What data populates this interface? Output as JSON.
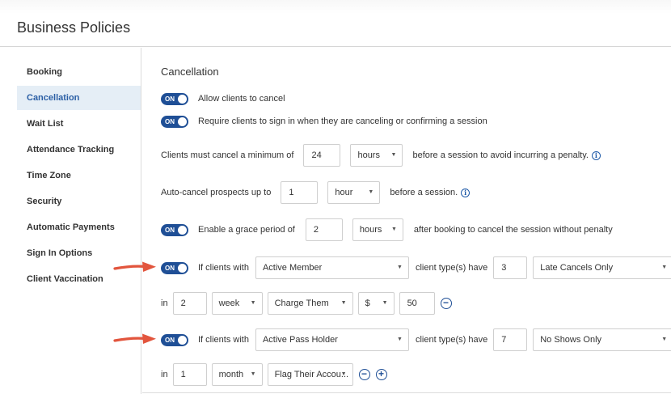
{
  "page": {
    "title": "Business Policies"
  },
  "sidebar": {
    "items": [
      {
        "label": "Booking",
        "active": false
      },
      {
        "label": "Cancellation",
        "active": true
      },
      {
        "label": "Wait List",
        "active": false
      },
      {
        "label": "Attendance Tracking",
        "active": false
      },
      {
        "label": "Time Zone",
        "active": false
      },
      {
        "label": "Security",
        "active": false
      },
      {
        "label": "Automatic Payments",
        "active": false
      },
      {
        "label": "Sign In Options",
        "active": false
      },
      {
        "label": "Client Vaccination",
        "active": false
      }
    ]
  },
  "cancellation": {
    "title": "Cancellation",
    "toggle_label": "ON",
    "allow_cancel": {
      "label": "Allow clients to cancel"
    },
    "require_sign_in": {
      "label": "Require clients to sign in when they are canceling or confirming a session"
    },
    "minimum": {
      "prefix": "Clients must cancel a minimum of",
      "value": "24",
      "unit": "hours",
      "suffix": "before a session to avoid incurring a penalty."
    },
    "auto_cancel": {
      "prefix": "Auto-cancel prospects up to",
      "value": "1",
      "unit": "hour",
      "suffix": "before a session."
    },
    "grace": {
      "prefix": "Enable a grace period of",
      "value": "2",
      "unit": "hours",
      "suffix": "after booking to cancel the session without penalty"
    },
    "rule_labels": {
      "if_clients_with": "If clients with",
      "client_types_have": "client type(s) have",
      "in": "in"
    },
    "rule1": {
      "client_type": "Active Member",
      "count": "3",
      "policy": "Late Cancels Only",
      "period_value": "2",
      "period_unit": "week",
      "action": "Charge Them",
      "currency": "$",
      "amount": "50"
    },
    "rule2": {
      "client_type": "Active Pass Holder",
      "count": "7",
      "policy": "No Shows Only",
      "period_value": "1",
      "period_unit": "month",
      "action": "Flag Their Accou..."
    }
  },
  "icons": {
    "caret": "▼",
    "info": "i",
    "minus": "−",
    "plus": "+"
  },
  "colors": {
    "toggle_on": "#1f4f96",
    "active_nav_bg": "#e5eef6",
    "arrow": "#e2553d"
  }
}
